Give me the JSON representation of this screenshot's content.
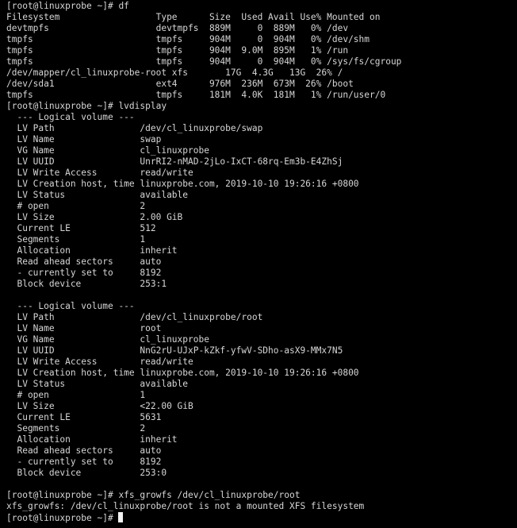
{
  "terminal": {
    "colors": {
      "background": "#000000",
      "foreground": "#d6d6d6",
      "cursor": "#f2f2f2"
    },
    "lines": [
      "[root@linuxprobe ~]# df",
      "Filesystem                  Type      Size  Used Avail Use% Mounted on",
      "devtmpfs                    devtmpfs  889M     0  889M   0% /dev",
      "tmpfs                       tmpfs     904M     0  904M   0% /dev/shm",
      "tmpfs                       tmpfs     904M  9.0M  895M   1% /run",
      "tmpfs                       tmpfs     904M     0  904M   0% /sys/fs/cgroup",
      "/dev/mapper/cl_linuxprobe-root xfs       17G  4.3G   13G  26% /",
      "/dev/sda1                   ext4      976M  236M  673M  26% /boot",
      "tmpfs                       tmpfs     181M  4.0K  181M   1% /run/user/0",
      "[root@linuxprobe ~]# lvdisplay",
      "  --- Logical volume ---",
      "  LV Path                /dev/cl_linuxprobe/swap",
      "  LV Name                swap",
      "  VG Name                cl_linuxprobe",
      "  LV UUID                UnrRI2-nMAD-2jLo-IxCT-68rq-Em3b-E4ZhSj",
      "  LV Write Access        read/write",
      "  LV Creation host, time linuxprobe.com, 2019-10-10 19:26:16 +0800",
      "  LV Status              available",
      "  # open                 2",
      "  LV Size                2.00 GiB",
      "  Current LE             512",
      "  Segments               1",
      "  Allocation             inherit",
      "  Read ahead sectors     auto",
      "  - currently set to     8192",
      "  Block device           253:1",
      "",
      "  --- Logical volume ---",
      "  LV Path                /dev/cl_linuxprobe/root",
      "  LV Name                root",
      "  VG Name                cl_linuxprobe",
      "  LV UUID                NnG2rU-UJxP-kZkf-yfwV-SDho-asX9-MMx7N5",
      "  LV Write Access        read/write",
      "  LV Creation host, time linuxprobe.com, 2019-10-10 19:26:16 +0800",
      "  LV Status              available",
      "  # open                 1",
      "  LV Size                <22.00 GiB",
      "  Current LE             5631",
      "  Segments               2",
      "  Allocation             inherit",
      "  Read ahead sectors     auto",
      "  - currently set to     8192",
      "  Block device           253:0",
      "",
      "[root@linuxprobe ~]# xfs_growfs /dev/cl_linuxprobe/root",
      "xfs_growfs: /dev/cl_linuxprobe/root is not a mounted XFS filesystem"
    ],
    "prompt": "[root@linuxprobe ~]# "
  }
}
